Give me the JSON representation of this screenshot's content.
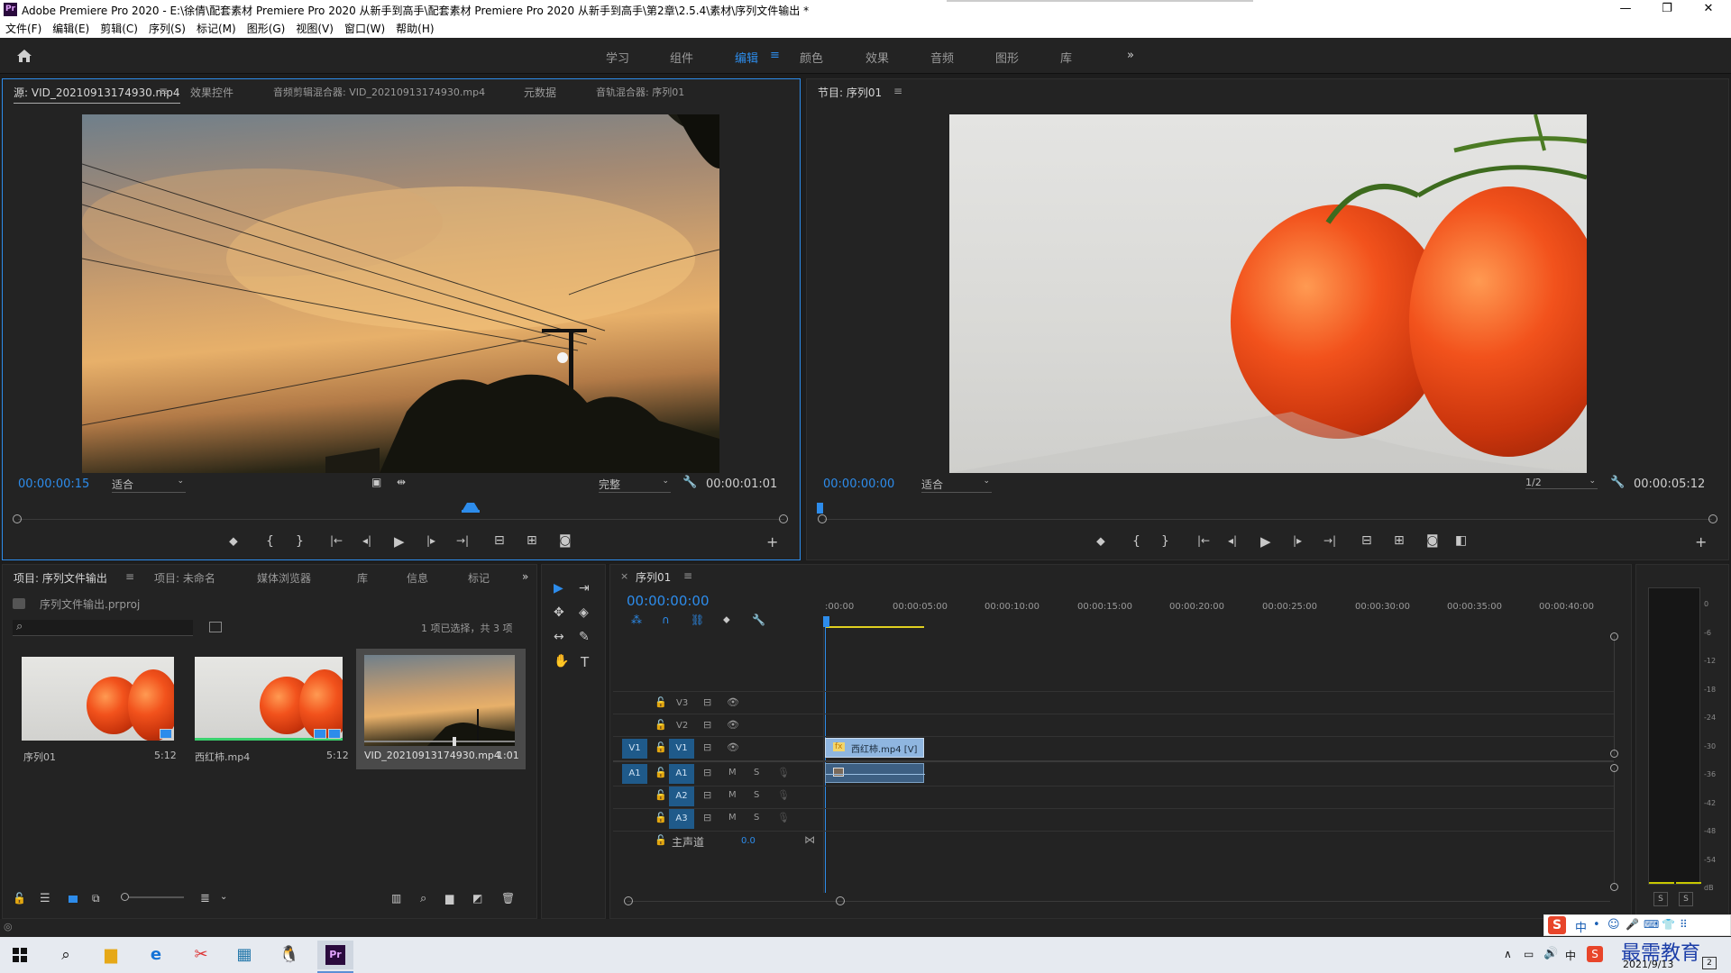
{
  "window": {
    "title": "Adobe Premiere Pro 2020 - E:\\徐倩\\配套素材 Premiere Pro 2020 从新手到高手\\配套素材 Premiere Pro 2020 从新手到高手\\第2章\\2.5.4\\素材\\序列文件输出 *",
    "app_icon_text": "Pr",
    "minimize": "—",
    "maximize": "❐",
    "close": "✕"
  },
  "menu": [
    "文件(F)",
    "编辑(E)",
    "剪辑(C)",
    "序列(S)",
    "标记(M)",
    "图形(G)",
    "视图(V)",
    "窗口(W)",
    "帮助(H)"
  ],
  "workspaces": {
    "items": [
      "学习",
      "组件",
      "编辑",
      "颜色",
      "效果",
      "音频",
      "图形",
      "库"
    ],
    "active": "编辑",
    "menu_glyph": "≡",
    "more": "»"
  },
  "source_panel": {
    "tabs": [
      "源: VID_20210913174930.mp4",
      "效果控件",
      "音频剪辑混合器: VID_20210913174930.mp4",
      "元数据",
      "音轨混合器: 序列01"
    ],
    "tab_menu": "≡",
    "timecode": "00:00:00:15",
    "zoom": "适合",
    "quality": "完整",
    "duration": "00:00:01:01"
  },
  "program_panel": {
    "tab": "节目: 序列01",
    "tab_menu": "≡",
    "timecode": "00:00:00:00",
    "zoom": "适合",
    "quality": "1/2",
    "duration": "00:00:05:12"
  },
  "transport_glyphs": {
    "marker": "⬥",
    "in": "{",
    "out": "}",
    "go_in": "|←",
    "step_back": "◂|",
    "play": "▶",
    "step_fwd": "|▸",
    "go_out": "→|",
    "insert": "⊟",
    "overwrite": "⊞",
    "export_frame": "◙",
    "compare": "◧",
    "add": "+"
  },
  "project_panel": {
    "tabs": [
      "项目: 序列文件输出",
      "项目: 未命名",
      "媒体浏览器",
      "库",
      "信息",
      "标记"
    ],
    "tab_menu": "≡",
    "more": "»",
    "file": "序列文件输出.prproj",
    "search_icon": "⌕",
    "selection_info": "1 项已选择，共 3 项",
    "items": [
      {
        "name": "序列01",
        "duration": "5:12"
      },
      {
        "name": "西红柿.mp4",
        "duration": "5:12"
      },
      {
        "name": "VID_20210913174930.mp4",
        "duration": "1:01"
      }
    ]
  },
  "tools": [
    "▶",
    "⇥",
    "✥",
    "◈",
    "↔",
    "✎",
    "✋",
    "T"
  ],
  "timeline": {
    "tab": "序列01",
    "close": "×",
    "tab_menu": "≡",
    "timecode": "00:00:00:00",
    "ruler_labels": [
      ":00:00",
      "00:00:05:00",
      "00:00:10:00",
      "00:00:15:00",
      "00:00:20:00",
      "00:00:25:00",
      "00:00:30:00",
      "00:00:35:00",
      "00:00:40:00"
    ],
    "tracks": [
      {
        "id": "V3",
        "source": ""
      },
      {
        "id": "V2",
        "source": ""
      },
      {
        "id": "V1",
        "source": "V1"
      },
      {
        "id": "A1",
        "source": "A1"
      },
      {
        "id": "A2",
        "source": ""
      },
      {
        "id": "A3",
        "source": ""
      }
    ],
    "mute_label": "M",
    "solo_label": "S",
    "master_label": "主声道",
    "master_value": "0.0",
    "clip_name": "西红柿.mp4 [V]",
    "clip_fx": "fx"
  },
  "meter": {
    "scale": [
      "0",
      "-6",
      "-12",
      "-18",
      "-24",
      "-30",
      "-36",
      "-42",
      "-48",
      "-54",
      "dB"
    ],
    "solo_buttons": [
      "S",
      "S"
    ]
  },
  "ime": {
    "items": [
      "中",
      "•",
      "☺",
      "🎤",
      "⌨",
      "👕",
      "⠿"
    ]
  },
  "taskbar": {
    "date": "2021/9/13",
    "watermark": "最需教育",
    "notification_count": "2"
  }
}
